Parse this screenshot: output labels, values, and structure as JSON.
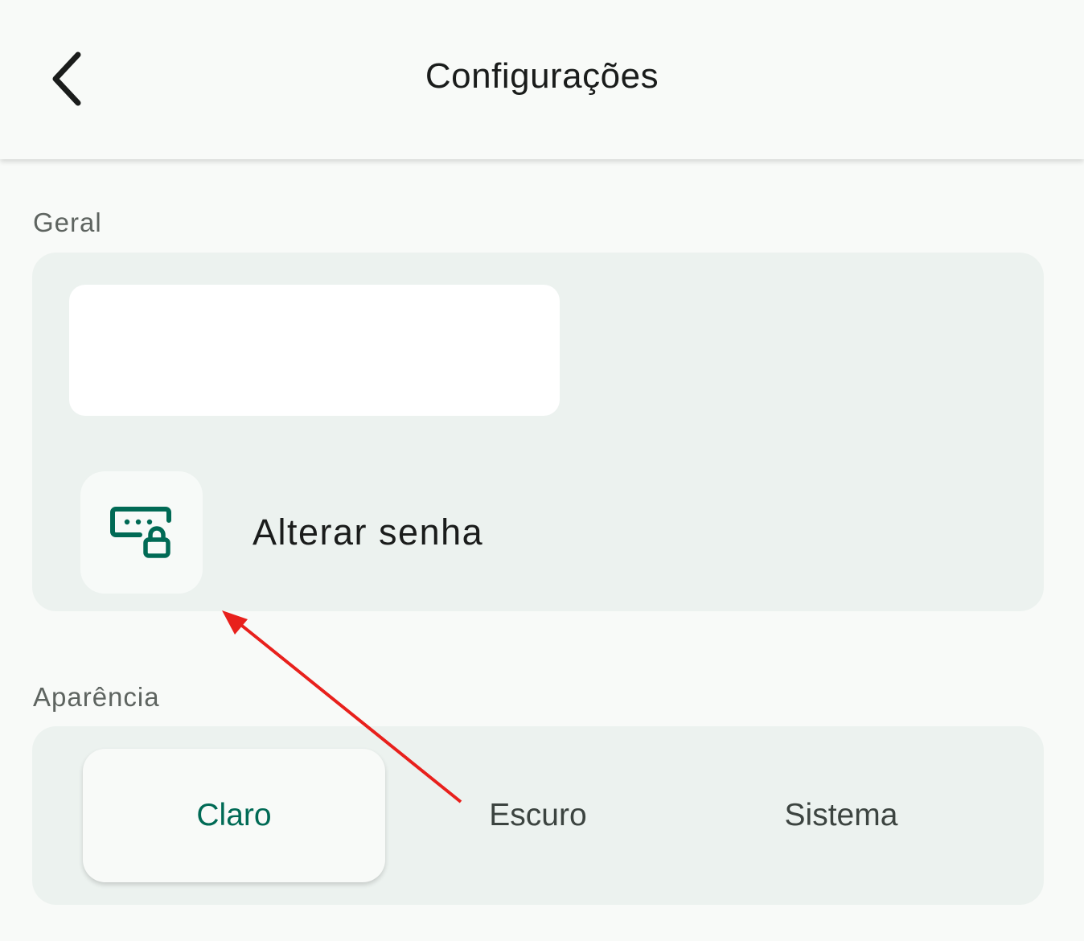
{
  "header": {
    "title": "Configurações",
    "back_icon": "chevron-left-icon"
  },
  "general": {
    "section_label": "Geral",
    "change_password": {
      "label": "Alterar senha",
      "icon": "password-lock-icon"
    }
  },
  "appearance": {
    "section_label": "Aparência",
    "options": [
      "Claro",
      "Escuro",
      "Sistema"
    ],
    "selected": "Claro"
  },
  "colors": {
    "accent": "#006a55",
    "annotation_arrow": "#e8201c"
  }
}
